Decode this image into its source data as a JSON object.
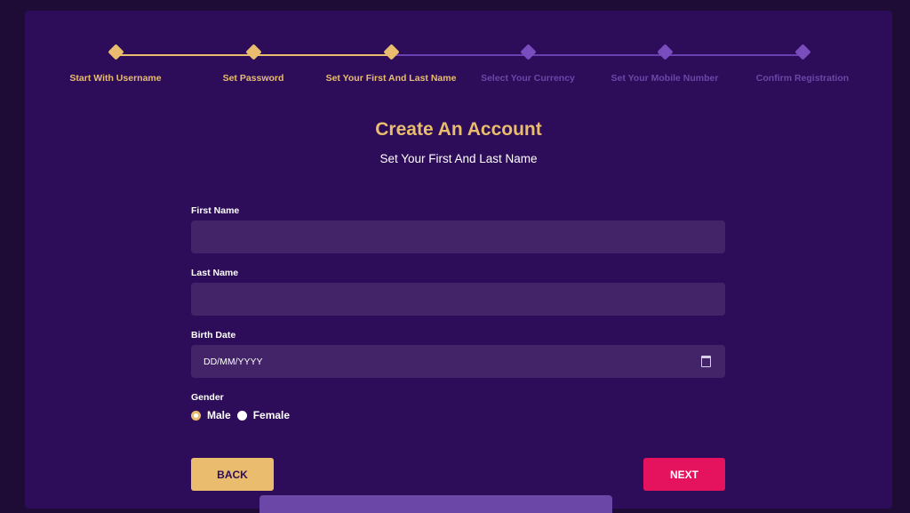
{
  "stepper": {
    "steps": [
      {
        "label": "Start With Username",
        "state": "done"
      },
      {
        "label": "Set Password",
        "state": "done"
      },
      {
        "label": "Set Your First And Last Name",
        "state": "done"
      },
      {
        "label": "Select Your Currency",
        "state": "todo"
      },
      {
        "label": "Set Your Mobile Number",
        "state": "todo"
      },
      {
        "label": "Confirm Registration",
        "state": "todo"
      }
    ],
    "current_step": 3
  },
  "header": {
    "title": "Create An Account",
    "subtitle": "Set Your First And Last Name"
  },
  "form": {
    "first_name": {
      "label": "First Name",
      "value": ""
    },
    "last_name": {
      "label": "Last Name",
      "value": ""
    },
    "birth_date": {
      "label": "Birth Date",
      "placeholder": "DD/MM/YYYY",
      "icon": "calendar-icon"
    },
    "gender": {
      "label": "Gender",
      "options": [
        {
          "label": "Male",
          "checked": true
        },
        {
          "label": "Female",
          "checked": false
        }
      ]
    }
  },
  "buttons": {
    "back": "BACK",
    "next": "NEXT"
  },
  "colors": {
    "background": "#1e0b36",
    "panel": "#2d0d59",
    "accent_gold": "#e9bd6d",
    "accent_pink": "#e5135e",
    "input_bg": "#442469",
    "inactive_step": "#7a4dbf"
  }
}
